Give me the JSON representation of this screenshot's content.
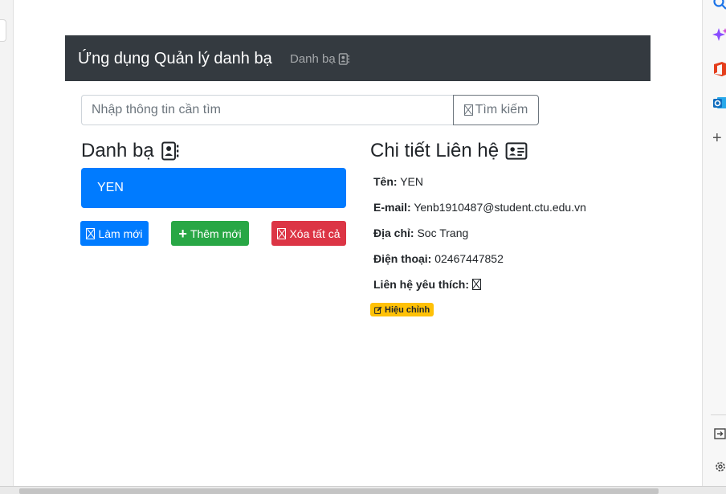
{
  "navbar": {
    "brand": "Ứng dụng Quản lý danh bạ",
    "link_label": "Danh bạ",
    "background": "#343a40"
  },
  "search": {
    "placeholder": "Nhập thông tin cần tìm",
    "button_label": "Tìm kiếm"
  },
  "contacts_panel": {
    "title": "Danh bạ",
    "items": [
      {
        "label": "YEN",
        "active": true
      }
    ],
    "buttons": {
      "refresh": "Làm mới",
      "add": "Thêm mới",
      "delete_all": "Xóa tất cả"
    }
  },
  "details_panel": {
    "title": "Chi tiết Liên hệ",
    "name_label": "Tên:",
    "name_value": "YEN",
    "email_label": "E-mail:",
    "email_value": "Yenb1910487@student.ctu.edu.vn",
    "address_label": "Địa chỉ:",
    "address_value": "Soc Trang",
    "phone_label": "Điện thoại:",
    "phone_value": "02467447852",
    "favorite_label": "Liên hệ yêu thích:",
    "edit_label": "Hiệu chỉnh"
  },
  "colors": {
    "primary": "#007bff",
    "success": "#28a745",
    "danger": "#dc3545",
    "warning": "#ffc107"
  },
  "icons": {
    "nav_link": "address-book-icon",
    "search_button": "missing-glyph-icon",
    "contacts_title": "address-book-icon",
    "details_title": "address-card-icon",
    "refresh": "missing-glyph-icon",
    "add": "plus-icon",
    "delete_all": "missing-glyph-icon",
    "favorite": "missing-glyph-icon",
    "edit": "edit-icon"
  }
}
